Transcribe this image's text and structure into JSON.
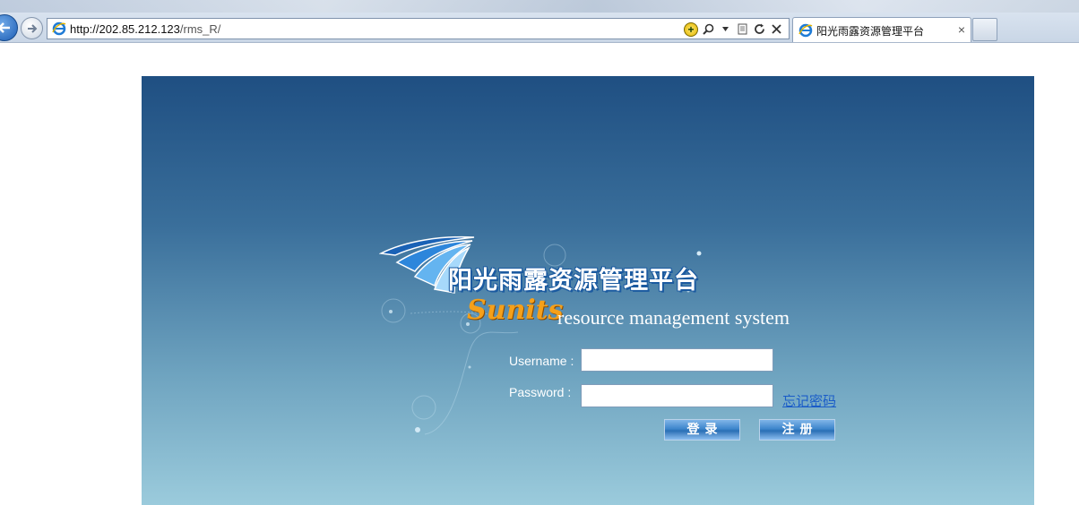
{
  "browser": {
    "url": "http://202.85.212.123/rms_R/",
    "url_host": "http://202.85.212.123",
    "url_path": "/rms_R/",
    "tab_title": "阳光雨露资源管理平台",
    "tab_close_glyph": "×",
    "icons": [
      "back-arrow-icon",
      "forward-arrow-icon",
      "ie-icon",
      "compatibility-view-icon",
      "search-icon",
      "dropdown-arrow-icon",
      "page-icon",
      "refresh-icon",
      "stop-icon"
    ]
  },
  "page": {
    "logo_cn": "阳光雨露资源管理平台",
    "brand": "Sunits",
    "tagline": "resource management system",
    "form": {
      "username_label": "Username :",
      "password_label": "Password  :",
      "username_value": "",
      "password_value": "",
      "forgot_link": "忘记密码",
      "login_button": "登录",
      "register_button": "注册"
    },
    "colors": {
      "panel_top": "#1f4f82",
      "panel_bottom": "#9bcbdc",
      "brand": "#f5a01a",
      "link": "#1a5cc8",
      "button": "#3e86cc"
    }
  }
}
